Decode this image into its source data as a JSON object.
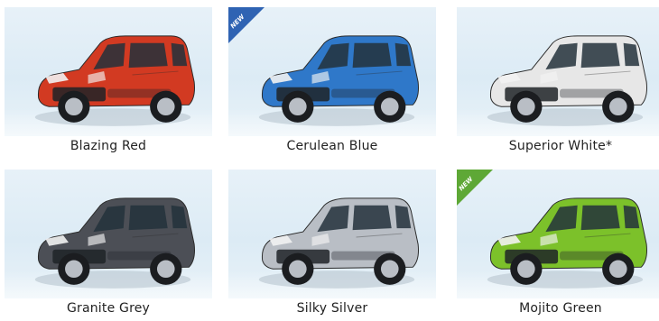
{
  "cars": [
    {
      "label": "Blazing Red",
      "badge": "",
      "color": "#d23a22"
    },
    {
      "label": "Cerulean Blue",
      "badge": "NEW",
      "badge_color": "#2f63b3",
      "color": "#2f78c9"
    },
    {
      "label": "Superior White*",
      "badge": "",
      "color": "#e7e7e7"
    },
    {
      "label": "Granite Grey",
      "badge": "",
      "color": "#4c4f56"
    },
    {
      "label": "Silky Silver",
      "badge": "",
      "color": "#b9bec5"
    },
    {
      "label": "Mojito Green",
      "badge": "NEW",
      "badge_color": "#5ea836",
      "color": "#7cc12a"
    }
  ]
}
